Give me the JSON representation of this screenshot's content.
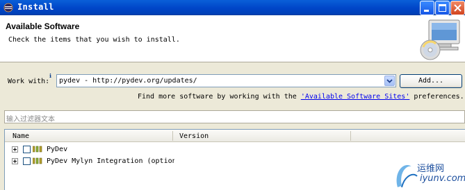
{
  "window": {
    "title": "Install",
    "controls": [
      "minimize-icon",
      "maximize-icon",
      "close-icon"
    ]
  },
  "header": {
    "title": "Available Software",
    "subtitle": "Check the items that you wish to install."
  },
  "work_with": {
    "label": "Work with:",
    "value": "pydev - http://pydev.org/updates/",
    "add_label": "Add..."
  },
  "find_more": {
    "prefix": "Find more software by working with the ",
    "link": "'Available Software Sites'",
    "suffix": " preferences."
  },
  "filter": {
    "placeholder": "输入过滤器文本"
  },
  "table": {
    "columns": [
      "Name",
      "Version"
    ],
    "rows": [
      {
        "name": "PyDev",
        "version": "",
        "checked": false
      },
      {
        "name": "PyDev Mylyn Integration (optional)",
        "version": "",
        "checked": false
      }
    ]
  },
  "watermark": {
    "cn": "运维网",
    "en": "iyunv.com"
  },
  "colors": {
    "titlebar": "#0046c8",
    "link": "#0000ee",
    "dialog_bg": "#ece9d8"
  }
}
